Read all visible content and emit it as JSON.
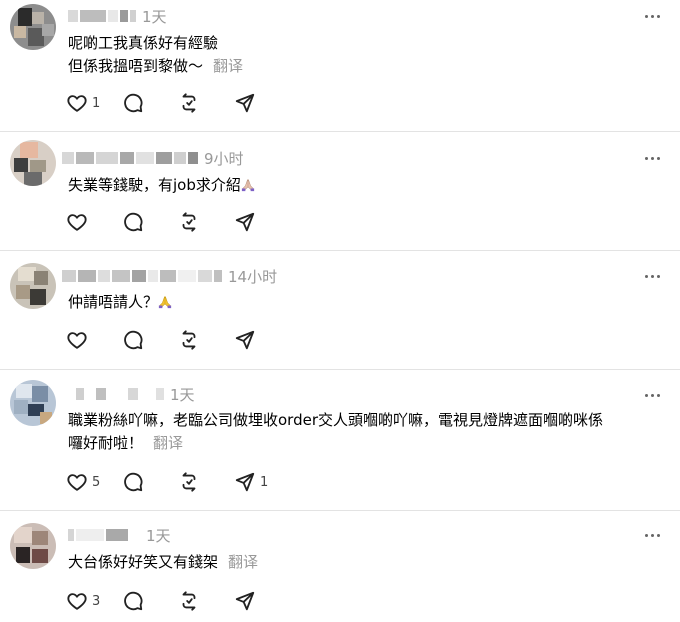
{
  "posts": [
    {
      "time": "1天",
      "lines": [
        "呢啲工我真係好有經驗",
        "但係我搵唔到黎做～"
      ],
      "translate": "翻译",
      "likes": "1",
      "shares": ""
    },
    {
      "time": "9小时",
      "lines": [
        "失業等錢駛，有job求介紹"
      ],
      "translate": "",
      "likes": "",
      "shares": ""
    },
    {
      "time": "14小时",
      "lines": [
        "仲請唔請人？"
      ],
      "translate": "",
      "likes": "",
      "shares": ""
    },
    {
      "time": "1天",
      "lines": [
        "職業粉絲吖嘛，老臨公司做埋收order交人頭嗰啲吖嘛，電視見燈牌遮面嗰啲咪係",
        "囉好耐啦！"
      ],
      "translate": "翻译",
      "likes": "5",
      "shares": "1"
    },
    {
      "time": "1天",
      "lines": [
        "大台係好好笑又有錢架"
      ],
      "translate": "翻译",
      "likes": "3",
      "shares": ""
    }
  ],
  "icons": [
    "heart-icon",
    "comment-icon",
    "repost-icon",
    "share-icon",
    "more-icon"
  ],
  "colors": {
    "muted": "#999999",
    "divider": "#e3e3e3",
    "icon": "#222222"
  }
}
